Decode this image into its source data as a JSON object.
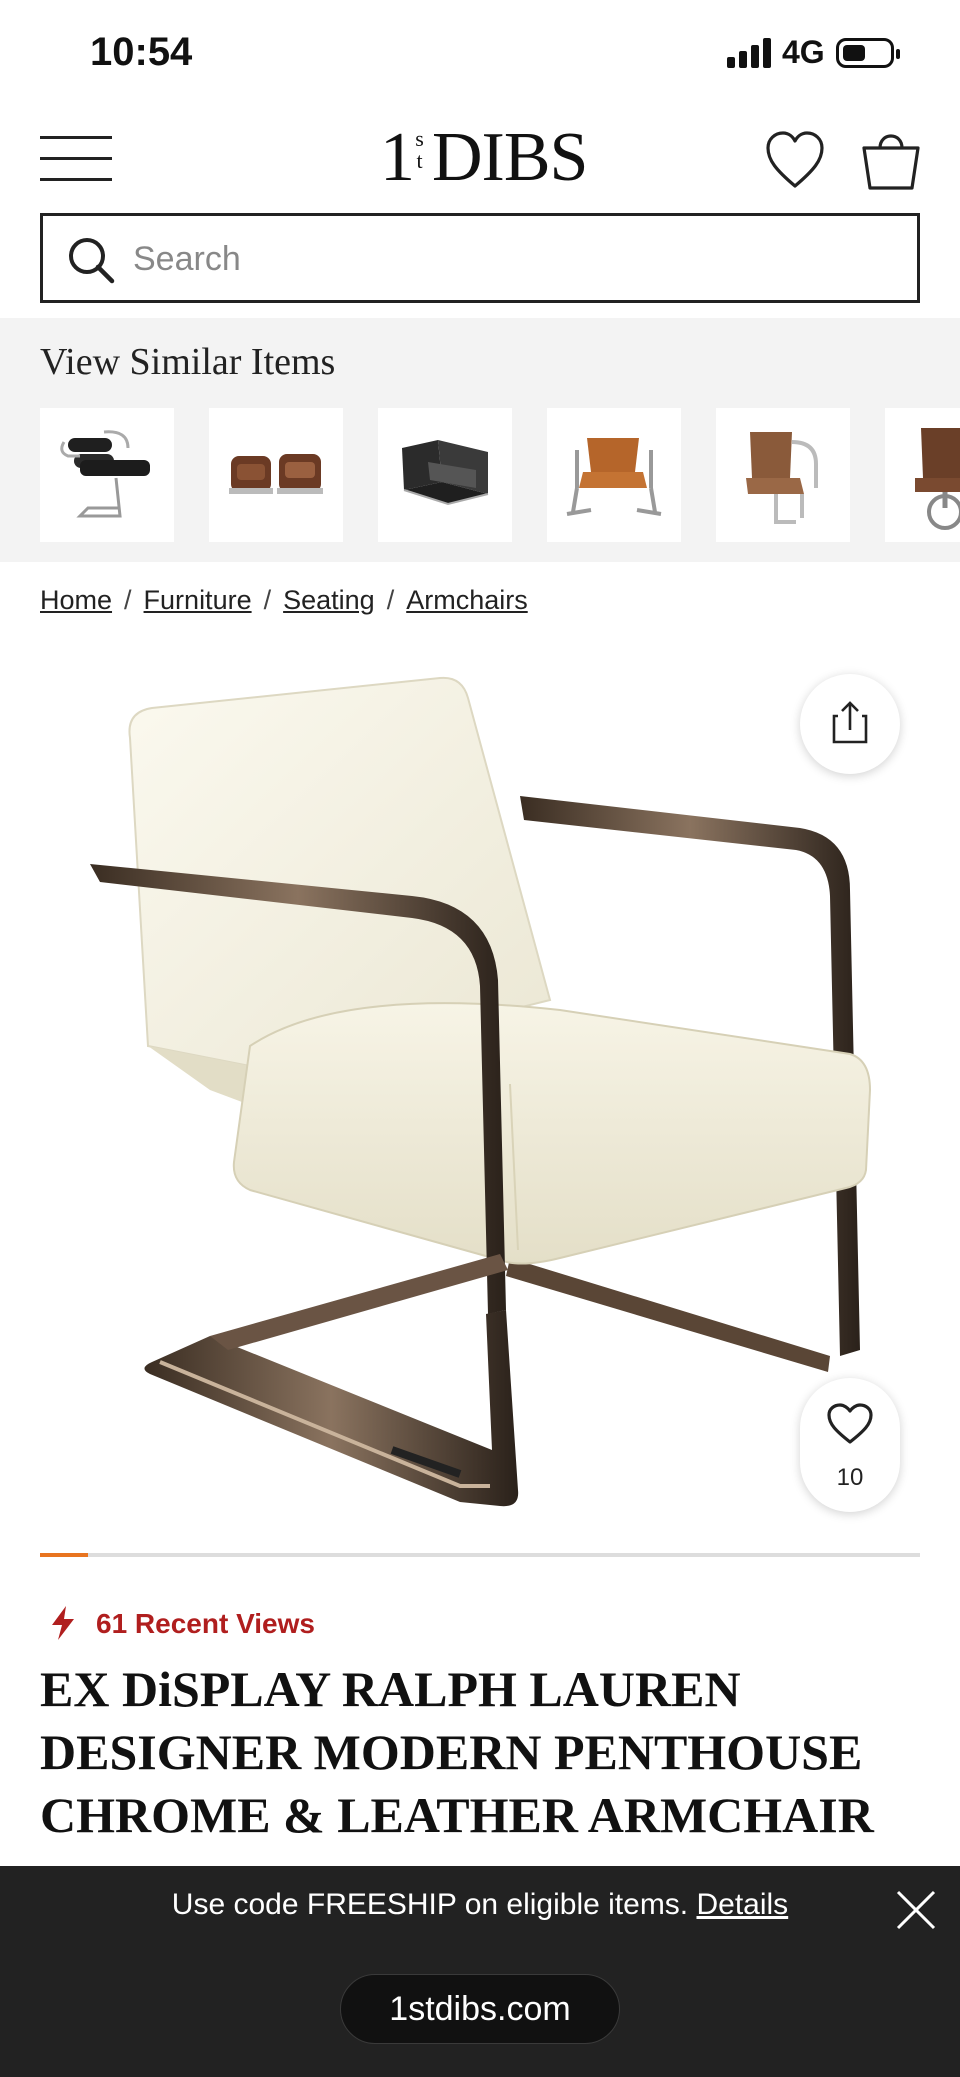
{
  "status_bar": {
    "time": "10:54",
    "network": "4G",
    "signal_icon": "signal-bars-icon",
    "battery_icon": "battery-icon"
  },
  "header": {
    "logo": {
      "numeral": "1",
      "superscript_top": "s",
      "superscript_bottom": "t",
      "wordmark": "DIBS"
    },
    "menu_icon": "hamburger-menu-icon",
    "favorites_icon": "heart-outline-icon",
    "cart_icon": "shopping-bag-icon"
  },
  "search": {
    "placeholder": "Search",
    "icon": "search-icon"
  },
  "similar_items": {
    "title": "View Similar Items",
    "items": [
      {
        "label": "black leather chrome armchair"
      },
      {
        "label": "brown leather aviator armchairs"
      },
      {
        "label": "black leather club chairs"
      },
      {
        "label": "tan leather sling chair"
      },
      {
        "label": "brown leather chrome chair"
      },
      {
        "label": "brown leather swivel chair"
      }
    ]
  },
  "breadcrumb": [
    "Home",
    "Furniture",
    "Seating",
    "Armchairs"
  ],
  "product": {
    "image_alt": "White leather armchair with chrome cantilever frame",
    "share_icon": "share-icon",
    "favorite_icon": "heart-outline-icon",
    "favorite_count": "10",
    "image_progress": 0.055,
    "recent_views_icon": "lightning-bolt-icon",
    "recent_views": "61 Recent Views",
    "title": "EX DiSPLAY RALPH LAUREN DESIGNER MODERN PENTHOUSE CHROME & LEATHER ARMCHAIR"
  },
  "promo": {
    "text": "Use code FREESHIP on eligible items.",
    "link": "Details",
    "close_icon": "close-icon",
    "url": "1stdibs.com"
  },
  "colors": {
    "accent_progress": "#e8741f",
    "recent_views": "#b01e1e",
    "banner_bg": "#222222"
  }
}
